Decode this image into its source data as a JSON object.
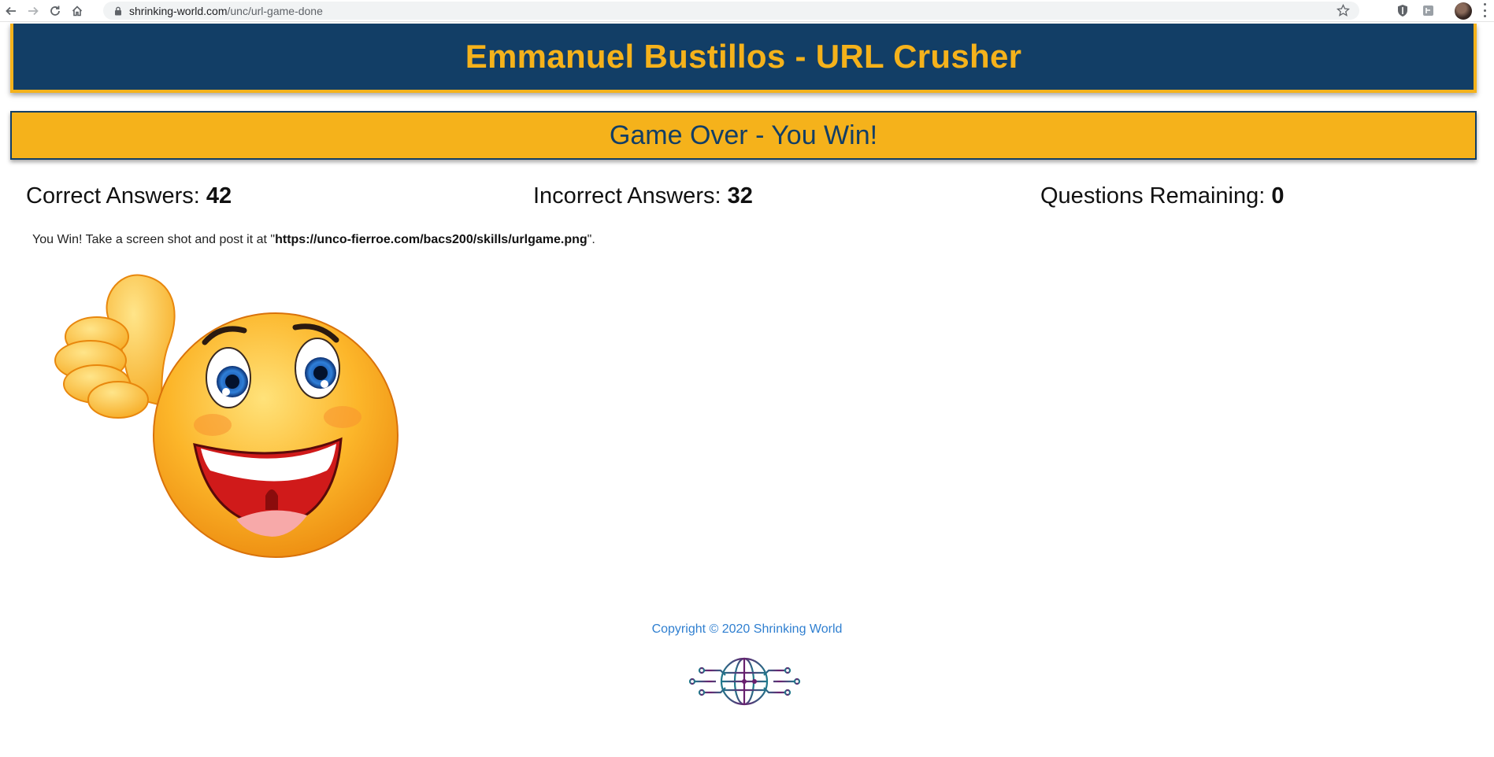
{
  "browser": {
    "url_host": "shrinking-world.com",
    "url_path": "/unc/url-game-done"
  },
  "header": {
    "title": "Emmanuel Bustillos - URL Crusher"
  },
  "status": {
    "title": "Game Over - You Win!"
  },
  "scores": {
    "correct_label": "Correct Answers:",
    "correct_value": "42",
    "incorrect_label": "Incorrect Answers:",
    "incorrect_value": "32",
    "remaining_label": "Questions Remaining:",
    "remaining_value": "0"
  },
  "message": {
    "prefix": "You Win! Take a screen shot and post it at \"",
    "url": "https://unco-fierroe.com/bacs200/skills/urlgame.png",
    "suffix": "\"."
  },
  "footer": {
    "copyright": "Copyright © 2020 Shrinking World"
  },
  "colors": {
    "navy": "#123e66",
    "gold": "#f5b21b",
    "link_blue": "#2f7fd0"
  },
  "icons": [
    "back-arrow-icon",
    "forward-arrow-icon",
    "reload-icon",
    "home-icon",
    "lock-icon",
    "star-icon",
    "shield-extension-icon",
    "extension-icon",
    "profile-avatar",
    "menu-dots-icon",
    "thumbs-up-smiley-image",
    "shrinking-world-globe-logo"
  ]
}
